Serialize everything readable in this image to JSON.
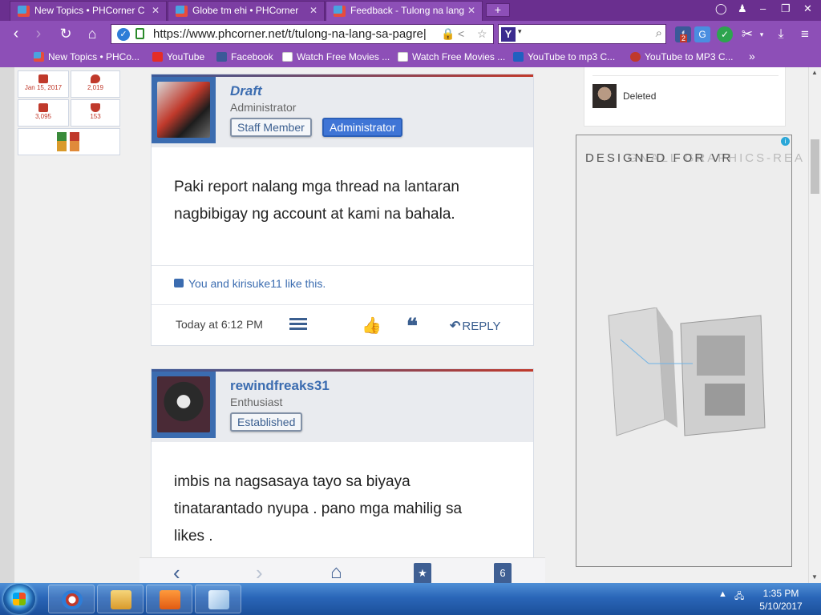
{
  "browser": {
    "tabs": [
      {
        "label": "New Topics • PHCorner C",
        "active": false
      },
      {
        "label": "Globe tm ehi • PHCorner",
        "active": false
      },
      {
        "label": "Feedback - Tulong na lang",
        "active": true
      }
    ],
    "url": "https://www.phcorner.net/t/tulong-na-lang-sa-pagre|",
    "search_value": "",
    "bookmarks": [
      {
        "label": "New Topics • PHCo...",
        "icon": "cube-icon"
      },
      {
        "label": "YouTube",
        "icon": "youtube-icon"
      },
      {
        "label": "Facebook",
        "icon": "facebook-icon"
      },
      {
        "label": "Watch Free Movies ...",
        "icon": "page-icon"
      },
      {
        "label": "Watch Free Movies ...",
        "icon": "page-icon"
      },
      {
        "label": "YouTube to mp3 C...",
        "icon": "mp3-icon"
      },
      {
        "label": "YouTube to MP3 C...",
        "icon": "youtube-red-icon"
      }
    ],
    "extension_badge": "2"
  },
  "sidebar_stats": [
    {
      "value": "Jan 15, 2017",
      "icon": "calendar-icon"
    },
    {
      "value": "2,019",
      "icon": "message-icon"
    },
    {
      "value": "3,095",
      "icon": "like-icon"
    },
    {
      "value": "153",
      "icon": "trophy-icon"
    }
  ],
  "posts": [
    {
      "username": "Draft",
      "title": "Administrator",
      "badges": [
        "Staff Member",
        "Administrator"
      ],
      "body_lines": [
        "Paki report nalang mga thread na lantaran",
        "nagbibigay ng account at kami na bahala."
      ],
      "likes_text": "You and kirisuke11 like this.",
      "time": "Today at 6:12 PM",
      "reply_label": "REPLY"
    },
    {
      "username": "rewindfreaks31",
      "title": "Enthusiast",
      "badges": [
        "Established"
      ],
      "body_lines": [
        "imbis na nagsasaya tayo sa biyaya",
        "tinatarantado nyupa . pano mga mahilig sa",
        "likes ."
      ]
    }
  ],
  "mobile_nav": {
    "tabs_count": "6"
  },
  "right_sidebar": {
    "member_name": "Deleted",
    "ad_text_front": "DESIGNED FOR VR",
    "ad_text_back": "GNALL GRAPHICS-REA"
  },
  "taskbar": {
    "time": "1:35 PM",
    "date": "5/10/2017"
  },
  "colors": {
    "browser_purple": "#8d4fb7",
    "link_blue": "#3b6cb0",
    "admin_badge": "#3f75d6",
    "like_green": "#6ab04c"
  }
}
